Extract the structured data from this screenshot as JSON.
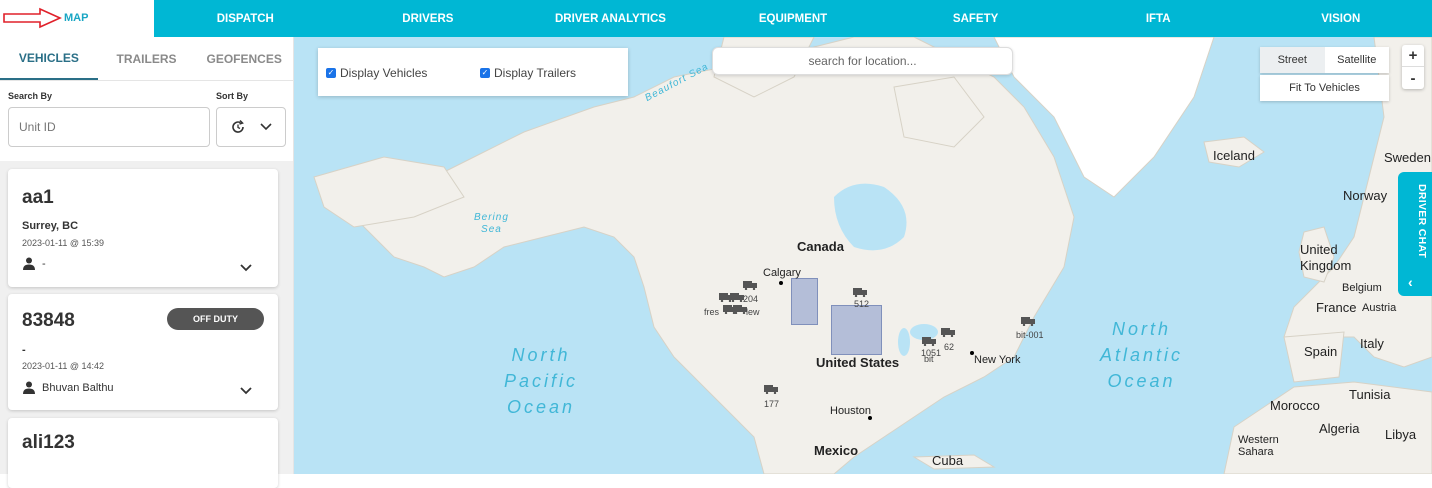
{
  "nav": {
    "items": [
      "MAP",
      "DISPATCH",
      "DRIVERS",
      "DRIVER ANALYTICS",
      "EQUIPMENT",
      "SAFETY",
      "IFTA",
      "VISION"
    ]
  },
  "sidebar": {
    "tabs": [
      "VEHICLES",
      "TRAILERS",
      "GEOFENCES"
    ],
    "search_label": "Search By",
    "sort_label": "Sort By",
    "search_placeholder": "Unit ID"
  },
  "vehicles": [
    {
      "unit": "aa1",
      "location": "Surrey, BC",
      "timestamp": "2023-01-11 @ 15:39",
      "driver": "-"
    },
    {
      "unit": "83848",
      "status": "OFF DUTY",
      "location": "-",
      "timestamp": "2023-01-11 @ 14:42",
      "driver": "Bhuvan Balthu"
    },
    {
      "unit": "ali123"
    }
  ],
  "map": {
    "display_vehicles": "Display Vehicles",
    "display_trailers": "Display Trailers",
    "search_placeholder": "search for location...",
    "map_types": [
      "Street",
      "Satellite"
    ],
    "active_map_type": "Street",
    "fit_button": "Fit To Vehicles",
    "zoom_in": "+",
    "zoom_out": "-",
    "driver_chat": "DRIVER CHAT",
    "labels": {
      "canada": "Canada",
      "calgary": "Calgary",
      "united_states": "United States",
      "houston": "Houston",
      "mexico": "Mexico",
      "cuba": "Cuba",
      "new_york": "New York",
      "iceland": "Iceland",
      "sweden": "Sweden",
      "norway": "Norway",
      "united_kingdom": "United\nKingdom",
      "belgium": "Belgium",
      "france": "France",
      "austria": "Austria",
      "spain": "Spain",
      "italy": "Italy",
      "morocco": "Morocco",
      "tunisia": "Tunisia",
      "algeria": "Algeria",
      "libya": "Libya",
      "western_sahara": "Western\nSahara"
    },
    "oceans": {
      "north_pacific": "North\nPacific\nOcean",
      "north_atlantic": "North\nAtlantic\nOcean",
      "bering_sea": "Bering\nSea",
      "beaufort_sea": "Beaufort Sea"
    },
    "truck_labels": [
      "204",
      "512",
      "fres",
      "lew",
      "1051",
      "bit",
      "62",
      "bit-001",
      "177"
    ]
  },
  "colors": {
    "accent": "#00b7d4",
    "water": "#b9e3f5",
    "land": "#f2f0eb",
    "geofence": "#8ea0cf"
  }
}
